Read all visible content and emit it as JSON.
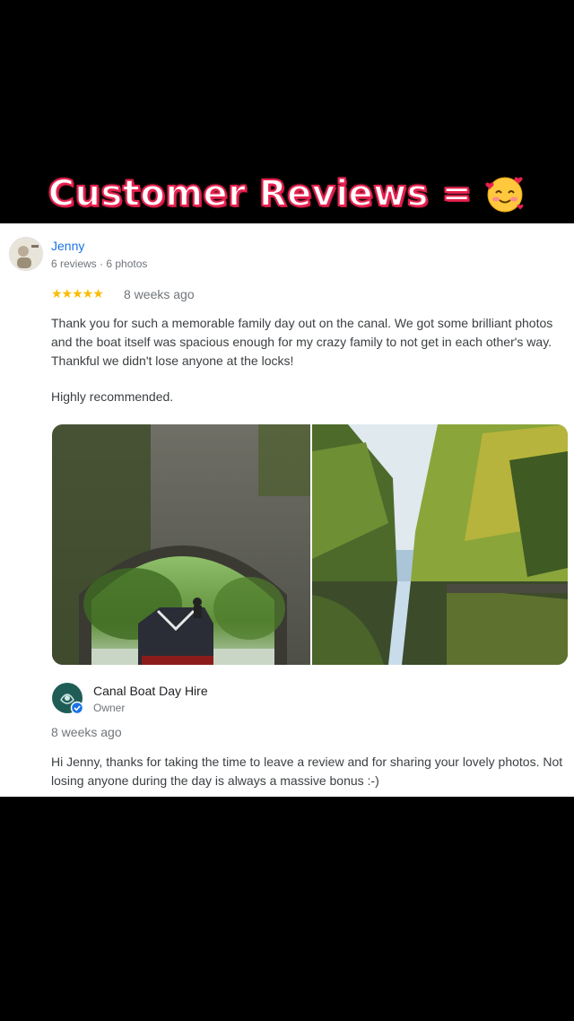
{
  "headline": {
    "text": "Customer Reviews =",
    "emoji_icon": "smiling-face-with-hearts-icon"
  },
  "review": {
    "reviewer_name": "Jenny",
    "reviewer_meta": "6 reviews · 6 photos",
    "rating": 5,
    "stars_text": "★★★★★",
    "age": "8 weeks ago",
    "text": "Thank you for such a memorable family day out on the canal. We got some brilliant photos and the boat itself was spacious enough for my crazy family to not get in each other's way. Thankful we didn't lose anyone at the locks!",
    "extra": "Highly recommended.",
    "photos": [
      "canal-bridge-narrowboat-photo",
      "canal-autumn-reflection-photo"
    ]
  },
  "reply": {
    "owner_name": "Canal Boat Day Hire",
    "owner_role": "Owner",
    "age": "8 weeks ago",
    "text": "Hi Jenny, thanks for taking the time to leave a review and for sharing your lovely photos. Not losing anyone during the day is always a massive bonus :-)"
  },
  "colors": {
    "background": "#000000",
    "card": "#ffffff",
    "link": "#1a73e8",
    "star": "#fbbc04",
    "headline_stroke": "#e8214f"
  }
}
